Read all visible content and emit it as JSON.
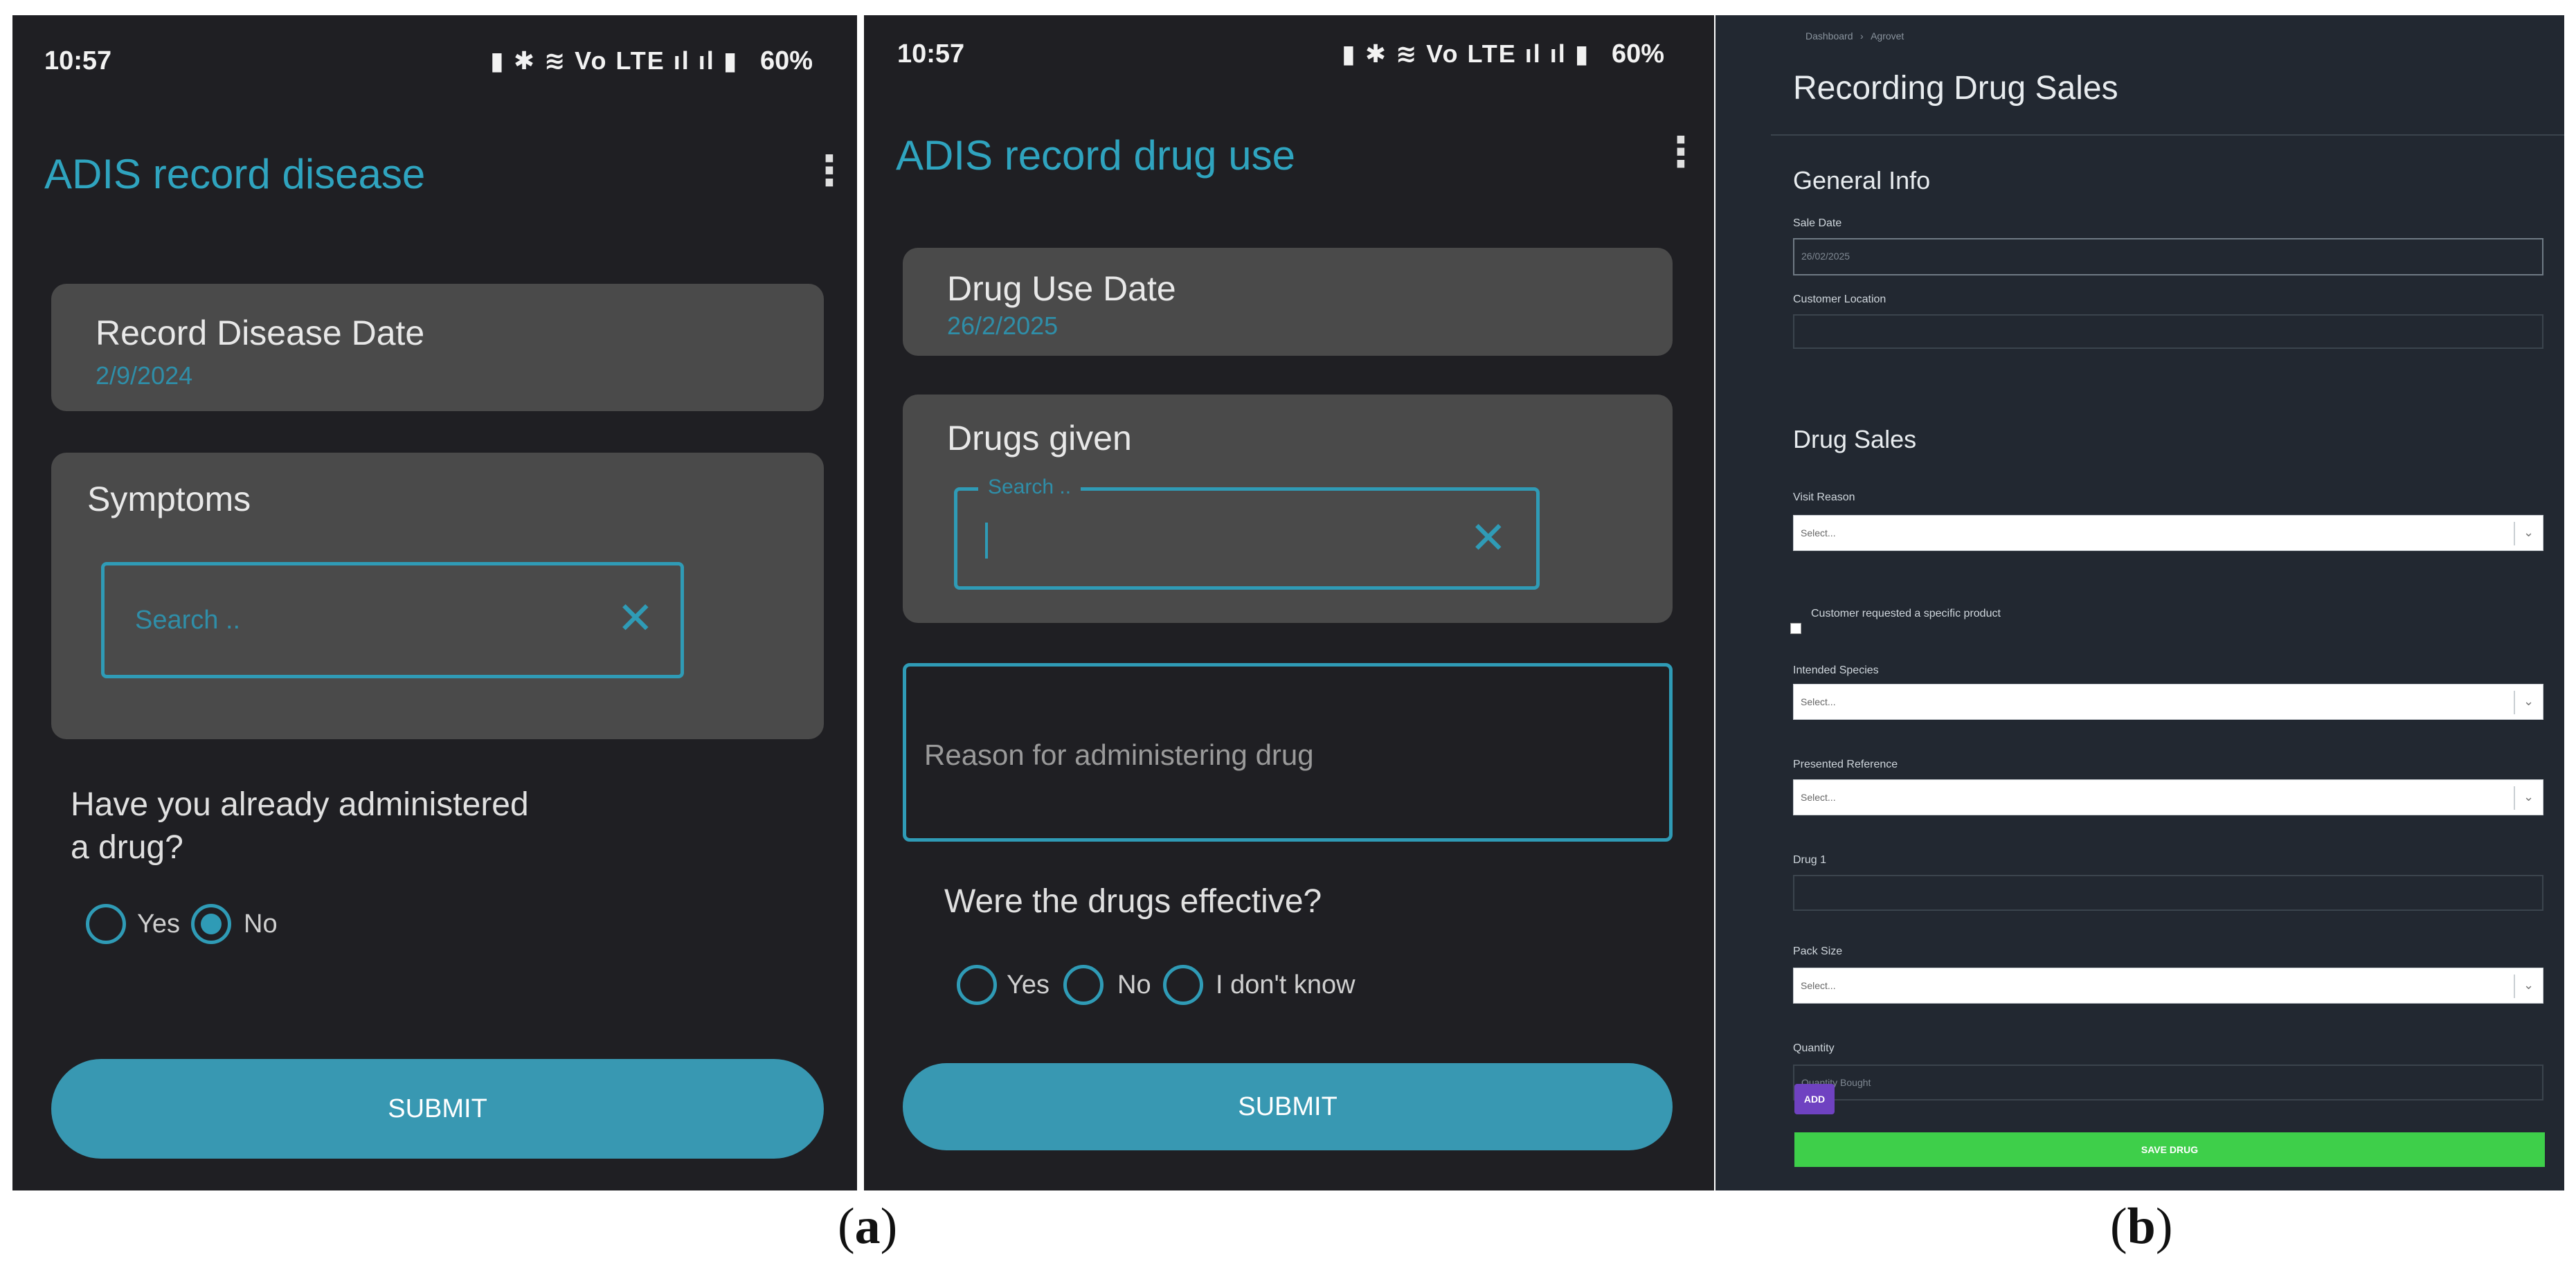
{
  "screen_a1": {
    "status": {
      "time": "10:57",
      "battery": "60%",
      "icons": "▮ ✱ ≋ Vo LTE ıl ıl ▮"
    },
    "title": "ADIS record disease",
    "date_card": {
      "label": "Record Disease Date",
      "value": "2/9/2024"
    },
    "symptoms_card": {
      "label": "Symptoms",
      "search_placeholder": "Search .."
    },
    "question": {
      "line1": "Have you already administered",
      "line2": "a drug?"
    },
    "options": [
      {
        "label": "Yes",
        "selected": false
      },
      {
        "label": "No",
        "selected": true
      }
    ],
    "submit": "SUBMIT"
  },
  "screen_a2": {
    "status": {
      "time": "10:57",
      "battery": "60%",
      "icons": "▮ ✱ ≋ Vo LTE ıl ıl ▮"
    },
    "title": "ADIS record drug use",
    "date_card": {
      "label": "Drug Use Date",
      "value": "26/2/2025"
    },
    "drugs_card": {
      "label": "Drugs given",
      "search_label": "Search .."
    },
    "reason_placeholder": "Reason for administering drug",
    "question": "Were the drugs effective?",
    "options": [
      {
        "label": "Yes",
        "selected": false
      },
      {
        "label": "No",
        "selected": false
      },
      {
        "label": "I don't know",
        "selected": false
      }
    ],
    "submit": "SUBMIT"
  },
  "screen_b": {
    "breadcrumb": {
      "first": "Dashboard",
      "separator": "›",
      "second": "Agrovet"
    },
    "title": "Recording Drug Sales",
    "general_info": {
      "heading": "General Info",
      "sale_date_label": "Sale Date",
      "sale_date_value": "26/02/2025",
      "customer_location_label": "Customer Location"
    },
    "drug_sales": {
      "heading": "Drug Sales",
      "visit_reason_label": "Visit Reason",
      "select_placeholder": "Select...",
      "specific_product_label": "Customer requested a specific product",
      "intended_species_label": "Intended Species",
      "presented_reference_label": "Presented Reference",
      "drug1_label": "Drug 1",
      "pack_size_label": "Pack Size",
      "quantity_label": "Quantity",
      "quantity_placeholder": "Quantity Bought",
      "add_button": "ADD",
      "save_button": "SAVE DRUG"
    }
  },
  "captions": {
    "a": "a",
    "b": "b"
  }
}
